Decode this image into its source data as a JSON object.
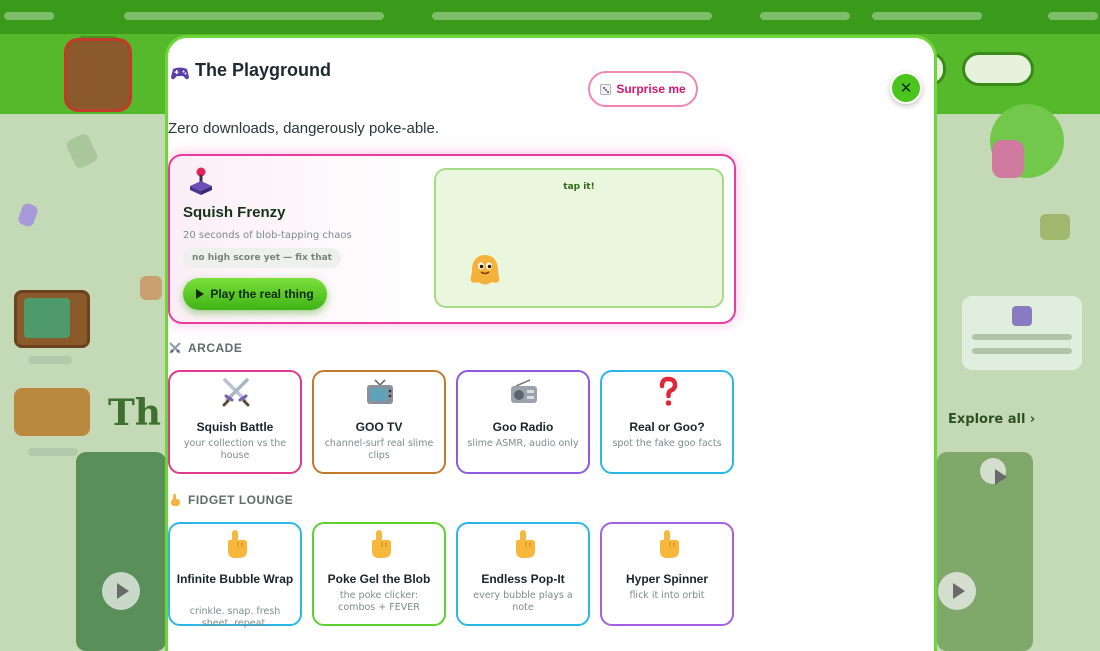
{
  "modal": {
    "title": "The Playground",
    "surprise_label": "Surprise me",
    "close_label": "✕",
    "subtitle": "Zero downloads, dangerously poke-able."
  },
  "featured": {
    "title": "Squish Frenzy",
    "description": "20 seconds of blob-tapping chaos",
    "high_score": "no high score yet — fix that",
    "play_label": "Play the real thing",
    "tap_hint": "tap it!"
  },
  "sections": [
    {
      "heading": "ARCADE",
      "cards": [
        {
          "title": "Squish Battle",
          "desc": "your collection vs the house",
          "border": "#e0388f",
          "icon": "crossed-swords-icon"
        },
        {
          "title": "GOO TV",
          "desc": "channel-surf real slime clips",
          "border": "#c27a2e",
          "icon": "tv-icon"
        },
        {
          "title": "Goo Radio",
          "desc": "slime ASMR, audio only",
          "border": "#8d5ae0",
          "icon": "radio-icon"
        },
        {
          "title": "Real or Goo?",
          "desc": "spot the fake goo facts",
          "border": "#2cb6e8",
          "icon": "question-mark-icon"
        }
      ]
    },
    {
      "heading": "FIDGET LOUNGE",
      "cards": [
        {
          "title": "Infinite Bubble Wrap",
          "desc": "crinkle. snap. fresh sheet. repeat.",
          "border": "#2cb6e8",
          "icon": "pointing-finger-icon"
        },
        {
          "title": "Poke Gel the Blob",
          "desc": "the poke clicker: combos + FEVER",
          "border": "#5ed12e",
          "icon": "pointing-finger-icon"
        },
        {
          "title": "Endless Pop-It",
          "desc": "every bubble plays a note",
          "border": "#2cb6e8",
          "icon": "pointing-finger-icon"
        },
        {
          "title": "Hyper Spinner",
          "desc": "flick it into orbit",
          "border": "#a55fe0",
          "icon": "pointing-finger-icon"
        }
      ]
    }
  ],
  "colors": {
    "modal_border": "#6fd63a",
    "accent_pink": "#e93ba0",
    "play_green": "#4cc41e"
  }
}
